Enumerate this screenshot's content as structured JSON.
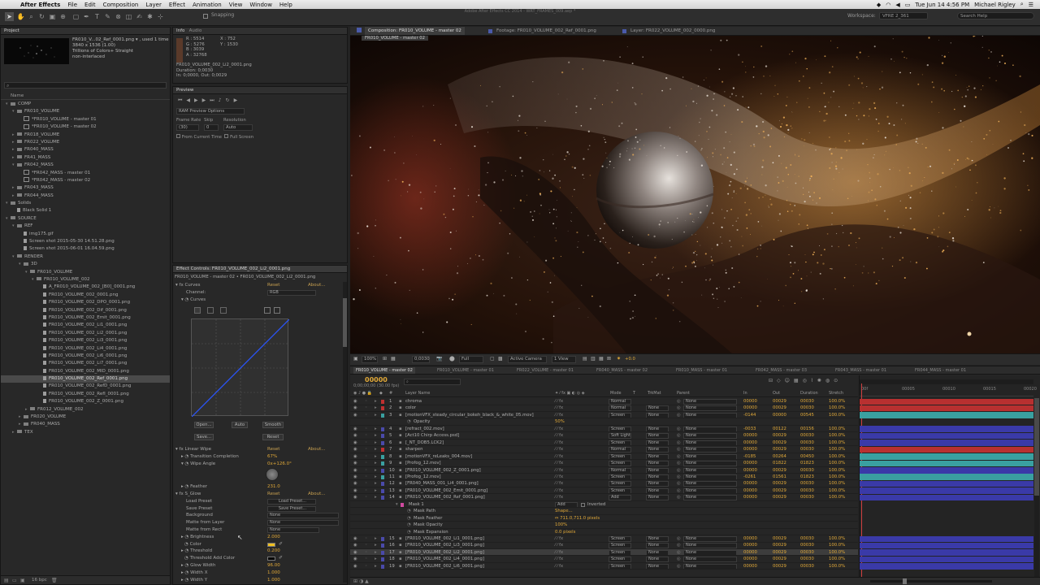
{
  "menubar": {
    "app_name": "After Effects",
    "menus": [
      "File",
      "Edit",
      "Composition",
      "Layer",
      "Effect",
      "Animation",
      "View",
      "Window",
      "Help"
    ],
    "clock": "Tue Jun 14  4:56 PM",
    "user": "Michael Rigley"
  },
  "toolbar": {
    "snapping_label": "Snapping",
    "window_title": "Adobe After Effects CC 2014 - WRT_FRAMES_009.aep *",
    "workspace_label": "Workspace:",
    "workspace_value": "VFRE 2_361",
    "search_placeholder": "Search Help"
  },
  "project": {
    "tab": "Project",
    "preview_name": "FR010_V...02_Ref_0001.png ▾ , used 1 time",
    "preview_info1": "3840 x 1536 (1.00)",
    "preview_info2": "Trillions of Colors+ Straight",
    "preview_info3": "non-interlaced",
    "col_name": "Name",
    "items": [
      {
        "t": "folder",
        "d": 0,
        "label": "COMP",
        "open": true
      },
      {
        "t": "folder",
        "d": 1,
        "label": "FR010_VOLUME",
        "open": true
      },
      {
        "t": "comp",
        "d": 2,
        "label": "*FR010_VOLUME - master 01"
      },
      {
        "t": "comp",
        "d": 2,
        "label": "*FR010_VOLUME - master 02"
      },
      {
        "t": "folder",
        "d": 1,
        "label": "FR018_VOLUME"
      },
      {
        "t": "folder",
        "d": 1,
        "label": "FR022_VOLUME"
      },
      {
        "t": "folder",
        "d": 1,
        "label": "FR040_MASS"
      },
      {
        "t": "folder",
        "d": 1,
        "label": "FR41_MASS"
      },
      {
        "t": "folder",
        "d": 1,
        "label": "FR042_MASS",
        "open": true
      },
      {
        "t": "comp",
        "d": 2,
        "label": "*FR042_MASS - master 01"
      },
      {
        "t": "comp",
        "d": 2,
        "label": "*FR042_MASS - master 02"
      },
      {
        "t": "folder",
        "d": 1,
        "label": "FR043_MASS"
      },
      {
        "t": "folder",
        "d": 1,
        "label": "FR044_MASS"
      },
      {
        "t": "folder",
        "d": 0,
        "label": "Solids",
        "open": true
      },
      {
        "t": "file",
        "d": 1,
        "label": "Black Solid 1"
      },
      {
        "t": "folder",
        "d": 0,
        "label": "SOURCE",
        "open": true
      },
      {
        "t": "folder",
        "d": 1,
        "label": "REF",
        "open": true
      },
      {
        "t": "file",
        "d": 2,
        "label": "img175.gif"
      },
      {
        "t": "file",
        "d": 2,
        "label": "Screen shot 2015-05-30 14.51.28.png"
      },
      {
        "t": "file",
        "d": 2,
        "label": "Screen shot 2015-06-01 16.04.59.png"
      },
      {
        "t": "folder",
        "d": 1,
        "label": "RENDER",
        "open": true
      },
      {
        "t": "folder",
        "d": 2,
        "label": "3D",
        "open": true
      },
      {
        "t": "folder",
        "d": 3,
        "label": "FR010_VOLUME",
        "open": true
      },
      {
        "t": "folder",
        "d": 4,
        "label": "FR010_VOLUME_002",
        "open": true
      },
      {
        "t": "file",
        "d": 5,
        "label": "A_FR010_VOLUME_002_[B0]_0001.png"
      },
      {
        "t": "file",
        "d": 5,
        "label": "FR010_VOLUME_002_0001.png"
      },
      {
        "t": "file",
        "d": 5,
        "label": "FR010_VOLUME_002_DPO_0001.png"
      },
      {
        "t": "file",
        "d": 5,
        "label": "FR010_VOLUME_002_Dif_0001.png"
      },
      {
        "t": "file",
        "d": 5,
        "label": "FR010_VOLUME_002_Emit_0001.png"
      },
      {
        "t": "file",
        "d": 5,
        "label": "FR010_VOLUME_002_Li1_0001.png"
      },
      {
        "t": "file",
        "d": 5,
        "label": "FR010_VOLUME_002_Li2_0001.png"
      },
      {
        "t": "file",
        "d": 5,
        "label": "FR010_VOLUME_002_Li3_0001.png"
      },
      {
        "t": "file",
        "d": 5,
        "label": "FR010_VOLUME_002_Li4_0001.png"
      },
      {
        "t": "file",
        "d": 5,
        "label": "FR010_VOLUME_002_Li6_0001.png"
      },
      {
        "t": "file",
        "d": 5,
        "label": "FR010_VOLUME_002_Li7_0001.png"
      },
      {
        "t": "file",
        "d": 5,
        "label": "FR010_VOLUME_002_MID_0001.png"
      },
      {
        "t": "file",
        "d": 5,
        "label": "FR010_VOLUME_002_Ref_0001.png",
        "sel": true
      },
      {
        "t": "file",
        "d": 5,
        "label": "FR010_VOLUME_002_RefD_0001.png"
      },
      {
        "t": "file",
        "d": 5,
        "label": "FR010_VOLUME_002_RefI_0001.png"
      },
      {
        "t": "file",
        "d": 5,
        "label": "FR010_VOLUME_002_Z_0001.png"
      },
      {
        "t": "folder",
        "d": 3,
        "label": "FR012_VOLUME_002"
      },
      {
        "t": "folder",
        "d": 2,
        "label": "FR020_VOLUME"
      },
      {
        "t": "folder",
        "d": 2,
        "label": "FR040_MASS"
      },
      {
        "t": "folder",
        "d": 1,
        "label": "TEX"
      }
    ],
    "bpc": "16 bpc"
  },
  "info": {
    "tab1": "Info",
    "tab2": "Audio",
    "r": "R : 5514",
    "g": "G : 5276",
    "b": "B : 3039",
    "a": "A : 32768",
    "x": "X : 752",
    "y": "Y : 1530",
    "file": "FR010_VOLUME_002_Li2_0001.png",
    "duration": "Duration: 0;0030",
    "inout": "In: 0;0000, Out: 0;0029"
  },
  "preview": {
    "tab": "Preview",
    "ram_options": "RAM Preview Options",
    "frame_rate_label": "Frame Rate",
    "skip_label": "Skip",
    "resolution_label": "Resolution",
    "frame_rate": "(30)",
    "skip": "0",
    "resolution": "Auto",
    "from_current": "From Current Time",
    "full_screen": "Full Screen"
  },
  "effects": {
    "tab": "Effect Controls: FR010_VOLUME_002_Li2_0001.png",
    "subtitle": "FR010_VOLUME - master 02 • FR010_VOLUME_002_Li2_0001.png",
    "curves_name": "Curves",
    "reset": "Reset",
    "about": "About...",
    "channel_label": "Channel:",
    "channel_value": "RGB",
    "curves_prop": "Curves",
    "btn_open": "Open...",
    "btn_auto": "Auto",
    "btn_smooth": "Smooth",
    "btn_save": "Save...",
    "btn_reset": "Reset",
    "linear_wipe": "Linear Wipe",
    "transition": "Transition Completion",
    "transition_val": "67%",
    "wipe_angle": "Wipe Angle",
    "wipe_angle_val": "0x+126.0°",
    "feather": "Feather",
    "feather_val": "231.0",
    "glow": "S_Glow",
    "load_preset": "Load Preset",
    "load_preset_btn": "Load Preset...",
    "save_preset": "Save Preset",
    "save_preset_btn": "Save Preset...",
    "background": "Background",
    "background_val": "None",
    "matte_layer": "Matte from Layer",
    "matte_layer_val": "None",
    "matte_rect": "Matte from Rect",
    "matte_rect_val": "None",
    "brightness": "Brightness",
    "brightness_val": "2.000",
    "color": "Color",
    "threshold": "Threshold",
    "threshold_val": "0.200",
    "threshold_add": "Threshold Add Color",
    "glow_width": "Glow Width",
    "glow_width_val": "96.00",
    "width_x": "Width X",
    "width_x_val": "1.000",
    "width_y": "Width Y",
    "width_y_val": "1.000"
  },
  "viewer": {
    "tab_comp": "Composition: FR010_VOLUME - master 02",
    "tab_footage": "Footage: FR010_VOLUME_002_Ref_0001.png",
    "tab_layer": "Layer: FR022_VOLUME_002_0000.png",
    "breadcrumb": "FR010_VOLUME - master 02",
    "zoom": "100%",
    "timecode": "0;0030",
    "res": "Full",
    "camera": "Active Camera",
    "views": "1 View",
    "exposure": "+0.0"
  },
  "timeline": {
    "tabs": [
      "FR010_VOLUME - master 02",
      "FR010_VOLUME - master 01",
      "FR022_VOLUME - master 01",
      "FR040_MASS - master 02",
      "FR010_MASS - master 01",
      "FR042_MASS - master 03",
      "FR043_MASS - master 01",
      "FR044_MASS - master 01"
    ],
    "timecode": "00000",
    "fps": "0;00;00;00 (30.00 fps)",
    "search_placeholder": "",
    "cols": {
      "layer": "Layer Name",
      "mode": "Mode",
      "trkmat": "TrkMat",
      "parent": "Parent",
      "in": "In",
      "out": "Out",
      "dur": "Duration",
      "stretch": "Stretch"
    },
    "ruler": [
      "00f",
      "00005",
      "00010",
      "00015",
      "00020"
    ],
    "layers": [
      {
        "n": "1",
        "name": "chroma",
        "c": "#c03030",
        "mode": "Normal",
        "trk": "",
        "par": "None",
        "in": "00000",
        "out": "00029",
        "dur": "00030",
        "st": "100.0%",
        "bar": "#b83030"
      },
      {
        "n": "2",
        "name": "color",
        "c": "#c03030",
        "mode": "Normal",
        "trk": "None",
        "par": "None",
        "in": "00000",
        "out": "00029",
        "dur": "00030",
        "st": "100.0%",
        "bar": "#b83030"
      },
      {
        "n": "3",
        "name": "[motionVFX_steady_circular_bokeh_black_&_white_05.mov]",
        "c": "#3aa0a0",
        "mode": "Screen",
        "trk": "None",
        "par": "None",
        "in": "-0144",
        "out": "00000",
        "dur": "00545",
        "st": "100.0%",
        "bar": "#3aa0a0"
      },
      {
        "n": "",
        "name": "Opacity",
        "prop": true,
        "pv": "50%"
      },
      {
        "n": "4",
        "name": "[refract_002.mov]",
        "c": "#4a4aaa",
        "mode": "Screen",
        "trk": "None",
        "par": "None",
        "in": "-0033",
        "out": "00122",
        "dur": "00156",
        "st": "100.0%",
        "bar": "#3a3aa8"
      },
      {
        "n": "5",
        "name": "[Act10 Chirp Access.psd]",
        "c": "#4a4aaa",
        "mode": "Soft Light",
        "trk": "None",
        "par": "None",
        "in": "00000",
        "out": "00029",
        "dur": "00030",
        "st": "100.0%",
        "bar": "#3a3aa8"
      },
      {
        "n": "6",
        "name": "[_NT_DOB5.LCK2]",
        "c": "#4a4aaa",
        "mode": "Screen",
        "trk": "None",
        "par": "None",
        "in": "00000",
        "out": "00029",
        "dur": "00030",
        "st": "100.0%",
        "bar": "#3a3aa8"
      },
      {
        "n": "7",
        "name": "sharpen",
        "c": "#c03030",
        "mode": "Normal",
        "trk": "None",
        "par": "None",
        "in": "00000",
        "out": "00029",
        "dur": "00030",
        "st": "100.0%",
        "bar": "#b83030"
      },
      {
        "n": "8",
        "name": "[motionVFX_reLeaks_004.mov]",
        "c": "#3aa0a0",
        "mode": "Screen",
        "trk": "None",
        "par": "None",
        "in": "-0185",
        "out": "00264",
        "dur": "00450",
        "st": "100.0%",
        "bar": "#3aa0a0"
      },
      {
        "n": "9",
        "name": "[Profog_12.mov]",
        "c": "#3aa0a0",
        "mode": "Screen",
        "trk": "None",
        "par": "None",
        "in": "00000",
        "out": "01822",
        "dur": "01823",
        "st": "100.0%",
        "bar": "#3aa0a0"
      },
      {
        "n": "10",
        "name": "[FR010_VOLUME_002_Z_0001.png]",
        "c": "#4a4aaa",
        "mode": "Normal",
        "trk": "None",
        "par": "None",
        "in": "00000",
        "out": "00029",
        "dur": "00030",
        "st": "100.0%",
        "bar": "#3a3aa8"
      },
      {
        "n": "11",
        "name": "[Profog_12.mov]",
        "c": "#3aa0a0",
        "mode": "Screen",
        "trk": "None",
        "par": "None",
        "in": "-0261",
        "out": "01561",
        "dur": "01823",
        "st": "100.0%",
        "bar": "#3aa0a0"
      },
      {
        "n": "12",
        "name": "[FR040_MASS_001_Li4_0001.png]",
        "c": "#4a4aaa",
        "mode": "Screen",
        "trk": "None",
        "par": "None",
        "in": "00000",
        "out": "00029",
        "dur": "00030",
        "st": "100.0%",
        "bar": "#3a3aa8"
      },
      {
        "n": "13",
        "name": "[FR010_VOLUME_002_Emit_0001.png]",
        "c": "#4a4aaa",
        "mode": "Screen",
        "trk": "None",
        "par": "None",
        "in": "00000",
        "out": "00029",
        "dur": "00030",
        "st": "100.0%",
        "bar": "#3a3aa8"
      },
      {
        "n": "14",
        "name": "[FR010_VOLUME_002_Ref_0001.png]",
        "c": "#4a4aaa",
        "mode": "Add",
        "trk": "None",
        "par": "None",
        "in": "00000",
        "out": "00029",
        "dur": "00030",
        "st": "100.0%",
        "bar": "#3a3aa8"
      },
      {
        "n": "",
        "name": "Mask 1",
        "mask": true,
        "pv": "Add",
        "inv": "Inverted"
      },
      {
        "n": "",
        "name": "Mask Path",
        "prop": true,
        "pv": "Shape..."
      },
      {
        "n": "",
        "name": "Mask Feather",
        "prop": true,
        "pv": "⇔ 711.0,711.0 pixels"
      },
      {
        "n": "",
        "name": "Mask Opacity",
        "prop": true,
        "pv": "100%"
      },
      {
        "n": "",
        "name": "Mask Expansion",
        "prop": true,
        "pv": "0.0 pixels"
      },
      {
        "n": "15",
        "name": "[FR010_VOLUME_002_Li1_0001.png]",
        "c": "#4a4aaa",
        "mode": "Screen",
        "trk": "None",
        "par": "None",
        "in": "00000",
        "out": "00029",
        "dur": "00030",
        "st": "100.0%",
        "bar": "#3a3aa8"
      },
      {
        "n": "16",
        "name": "[FR010_VOLUME_002_Li3_0001.png]",
        "c": "#4a4aaa",
        "mode": "Screen",
        "trk": "None",
        "par": "None",
        "in": "00000",
        "out": "00029",
        "dur": "00030",
        "st": "100.0%",
        "bar": "#3a3aa8"
      },
      {
        "n": "17",
        "name": "[FR010_VOLUME_002_Li2_0001.png]",
        "c": "#4a4aaa",
        "mode": "Screen",
        "trk": "None",
        "par": "None",
        "in": "00000",
        "out": "00029",
        "dur": "00030",
        "st": "100.0%",
        "bar": "#3a3aa8",
        "sel": true
      },
      {
        "n": "18",
        "name": "[FR010_VOLUME_002_Li4_0001.png]",
        "c": "#4a4aaa",
        "mode": "Screen",
        "trk": "None",
        "par": "None",
        "in": "00000",
        "out": "00029",
        "dur": "00030",
        "st": "100.0%",
        "bar": "#3a3aa8"
      },
      {
        "n": "19",
        "name": "[FR010_VOLUME_002_Li6_0001.png]",
        "c": "#4a4aaa",
        "mode": "Screen",
        "trk": "None",
        "par": "None",
        "in": "00000",
        "out": "00029",
        "dur": "00030",
        "st": "100.0%",
        "bar": "#3a3aa8"
      }
    ]
  }
}
